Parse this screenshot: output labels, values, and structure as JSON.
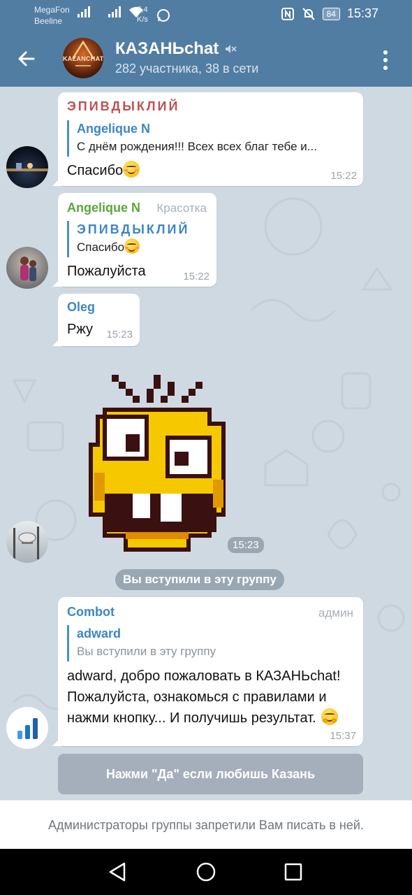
{
  "status_bar": {
    "carrier1": "MegaFon",
    "carrier2": "Beeline",
    "speed_value": "7,4",
    "speed_unit": "K/s",
    "battery": "84",
    "time": "15:37"
  },
  "header": {
    "title": "КАЗАНЬchat",
    "subtitle": "282 участника, 38 в сети",
    "avatar_logo_text": "KAZANCHAT"
  },
  "messages": [
    {
      "sender": "ЭПИВДЫКЛИЙ",
      "sender_color": "#c05050",
      "reply_name": "Angelique N",
      "reply_text": "С днём рождения!!! Всех всех благ тебе и...",
      "text": "Спасибо",
      "time": "15:22"
    },
    {
      "sender": "Angelique N",
      "sender_color": "#5aa83a",
      "title_tag": "Красотка",
      "reply_name": "ЭПИВДЫКЛИЙ",
      "reply_text": "Спасибо",
      "text": "Пожалуйста",
      "time": "15:22"
    },
    {
      "sender": "Oleg",
      "sender_color": "#3d86c6",
      "text": "Ржу",
      "time": "15:23"
    }
  ],
  "sticker": {
    "time": "15:23"
  },
  "service_message": "Вы вступили в эту группу",
  "bot_message": {
    "sender": "Combot",
    "sender_color": "#3d86c6",
    "role": "админ",
    "reply_name": "adward",
    "reply_text": "Вы вступили в эту группу",
    "text": "adward, добро пожаловать в КАЗАНЬchat! Пожалуйста, ознакомься с правилами и нажми кнопку... И получишь результат.",
    "time": "15:37"
  },
  "keyboard_button": "Нажми \"Да\" если любишь Казань",
  "footer_notice": "Администраторы группы запретили Вам писать в ней.",
  "colors": {
    "header_bg": "#527da3",
    "chat_bg": "#cfd9e2",
    "link_blue": "#3d86c6"
  }
}
